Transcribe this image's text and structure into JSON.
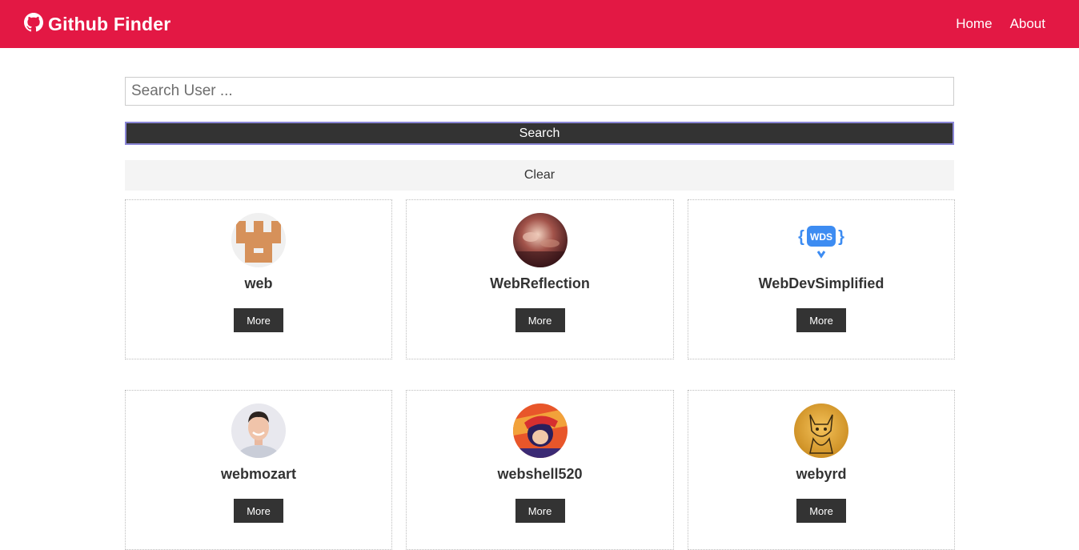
{
  "navbar": {
    "brand_icon": "github-icon",
    "title": "Github Finder",
    "links": [
      {
        "label": "Home"
      },
      {
        "label": "About"
      }
    ],
    "color": "#e31844"
  },
  "search": {
    "placeholder": "Search User ...",
    "value": "",
    "search_label": "Search",
    "clear_label": "Clear"
  },
  "users": [
    {
      "login": "web",
      "more_label": "More",
      "avatar": "tan-pixel-identicon"
    },
    {
      "login": "WebReflection",
      "more_label": "More",
      "avatar": "blurred-photo"
    },
    {
      "login": "WebDevSimplified",
      "more_label": "More",
      "avatar": "wds-logo"
    },
    {
      "login": "webmozart",
      "more_label": "More",
      "avatar": "person-photo"
    },
    {
      "login": "webshell520",
      "more_label": "More",
      "avatar": "anime-character"
    },
    {
      "login": "webyrd",
      "more_label": "More",
      "avatar": "cat-sketch"
    }
  ]
}
